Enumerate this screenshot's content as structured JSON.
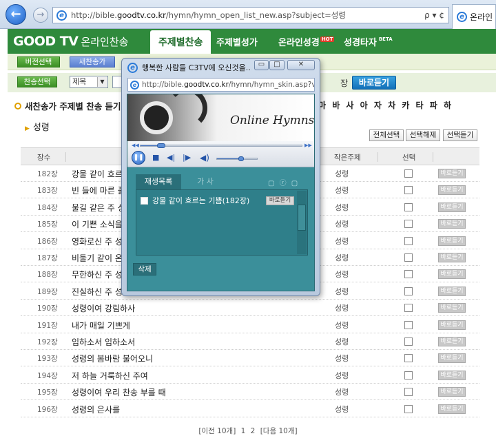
{
  "browser": {
    "url_prefix": "http://bible.",
    "url_domain": "goodtv.co.kr",
    "url_path": "/hymn/hymn_open_list_new.asp?subject=성령",
    "tools": "ρ ▾ ¢",
    "tab_title": "온라인"
  },
  "site": {
    "logo": "GOOD TV",
    "logo_sub": "온라인찬송",
    "menu": [
      {
        "label": "주제별찬송",
        "active": true
      },
      {
        "label": "주제별성가",
        "active": false
      },
      {
        "label": "온라인성경",
        "badge": "HOT"
      },
      {
        "label": "성경타자",
        "badge": "BETA"
      }
    ]
  },
  "subbar": {
    "version_btn": "버전선택",
    "new_hymn_btn": "새찬송가"
  },
  "search": {
    "hymn_select_btn": "찬송선택",
    "field_select": "제목",
    "jang_label": "장",
    "go_btn": "바로듣기"
  },
  "section": {
    "title": "새찬송가 주제별 찬송 듣기",
    "separator": "|",
    "consonants": "마 바 사 아 자 차 카 타 파 하",
    "subject": "성령"
  },
  "actions": {
    "select_all": "전체선택",
    "deselect": "선택해제",
    "listen_selected": "선택듣기"
  },
  "table": {
    "headers": {
      "num": "장수",
      "sub": "작은주제",
      "select": "선택"
    },
    "listen_label": "바로듣기",
    "rows": [
      {
        "num": "182장",
        "title": "강물 같이 흐르",
        "sub": "성령"
      },
      {
        "num": "183장",
        "title": "빈 들에 마른 풀",
        "sub": "성령"
      },
      {
        "num": "184장",
        "title": "불길 같은 주 성",
        "sub": "성령"
      },
      {
        "num": "185장",
        "title": "이 기쁜 소식을",
        "sub": "성령"
      },
      {
        "num": "186장",
        "title": "영화로신 주 성",
        "sub": "성령"
      },
      {
        "num": "187장",
        "title": "비둘기 같이 온",
        "sub": "성령"
      },
      {
        "num": "188장",
        "title": "무한하신 주 성",
        "sub": "성령"
      },
      {
        "num": "189장",
        "title": "진실하신 주 성",
        "sub": "성령"
      },
      {
        "num": "190장",
        "title": "성령이여 강림하사",
        "sub": "성령"
      },
      {
        "num": "191장",
        "title": "내가 매일 기쁘게",
        "sub": "성령"
      },
      {
        "num": "192장",
        "title": "임하소서 임하소서",
        "sub": "성령"
      },
      {
        "num": "193장",
        "title": "성령의 봄바람 불어오니",
        "sub": "성령"
      },
      {
        "num": "194장",
        "title": "저 하늘 거룩하신 주여",
        "sub": "성령"
      },
      {
        "num": "195장",
        "title": "성령이여 우리 찬송 부를 때",
        "sub": "성령"
      },
      {
        "num": "196장",
        "title": "성령의 은사를",
        "sub": "성령"
      }
    ]
  },
  "pagination": {
    "prev": "[이전 10개]",
    "page1": "1",
    "page2": "2",
    "next": "[다음 10개]"
  },
  "popup": {
    "title": "행복한 사람들 C3TV에 오신것을...",
    "url_prefix": "http://bible.",
    "url_domain": "goodtv.co.kr",
    "url_path": "/hymn/hymn_skin.asp?ver",
    "brand": "Online Hymns",
    "seek_progress": 0.12,
    "volume_level": 0.6,
    "tabs": {
      "playlist": "재생목록",
      "lyrics": "가 사"
    },
    "playlist_item": "강물 같이 흐르는 기쁨(182장)",
    "item_listen": "바로듣기",
    "delete_btn": "삭제",
    "win_min": "▭",
    "win_max": "□",
    "win_close": "✕"
  }
}
